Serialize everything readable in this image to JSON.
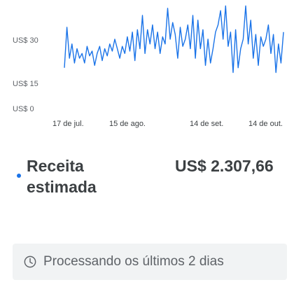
{
  "colors": {
    "line": "#1a73e8",
    "dot": "#1a73e8",
    "text": "#3c4043",
    "muted": "#5f6368",
    "notice_bg": "#f1f3f4"
  },
  "metric": {
    "label": "Receita estimada",
    "value": "US$ 2.307,66"
  },
  "notice": {
    "icon": "clock-icon",
    "text": "Processando os últimos 2 dias"
  },
  "chart_data": {
    "type": "line",
    "title": "",
    "xlabel": "",
    "ylabel": "",
    "ylim": [
      0,
      45
    ],
    "y_ticks": [
      "US$ 30",
      "US$ 15",
      "US$ 0"
    ],
    "y_tick_values": [
      30,
      15,
      0
    ],
    "x_ticks": [
      "17 de jul.",
      "15 de ago.",
      "14 de set.",
      "14 de out."
    ],
    "x_tick_values": [
      0,
      29,
      59,
      89
    ],
    "grid": false,
    "series": [
      {
        "values": [
          18,
          35,
          22,
          28,
          20,
          26,
          22,
          24,
          20,
          27,
          23,
          25,
          19,
          24,
          27,
          21,
          26,
          23,
          28,
          25,
          30,
          26,
          22,
          27,
          24,
          31,
          25,
          33,
          21,
          34,
          26,
          40,
          24,
          34,
          28,
          36,
          26,
          33,
          24,
          31,
          28,
          43,
          30,
          37,
          32,
          22,
          35,
          27,
          30,
          36,
          26,
          40,
          22,
          38,
          26,
          34,
          19,
          30,
          20,
          26,
          33,
          36,
          42,
          30,
          44,
          27,
          33,
          16,
          34,
          18,
          26,
          30,
          44,
          28,
          38,
          22,
          32,
          19,
          31,
          27,
          30,
          36,
          24,
          32,
          16,
          28,
          20,
          33
        ]
      }
    ]
  }
}
